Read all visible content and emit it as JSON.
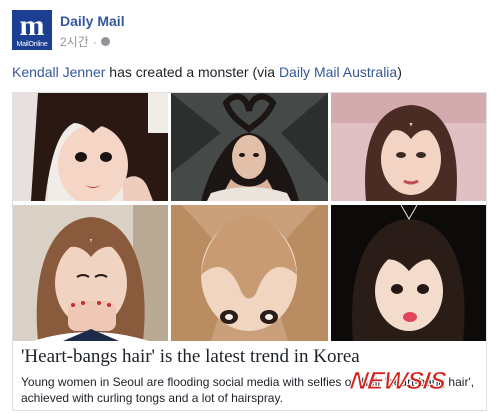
{
  "header": {
    "page_name": "Daily Mail",
    "timestamp": "2시간",
    "privacy_icon": "globe-icon",
    "avatar": {
      "logo_glyph": "m",
      "logo_text": "MailOnline",
      "bg_color": "#1c3f94"
    }
  },
  "caption": {
    "mention": "Kendall Jenner",
    "text_middle": " has created a monster (via ",
    "source_link": "Daily Mail Australia",
    "text_end": ")"
  },
  "link_card": {
    "photos": [
      "photo-1-heart-bangs",
      "photo-2-kendall-jenner",
      "photo-3-heart-bangs",
      "photo-4-heart-bangs",
      "photo-5-heart-bangs",
      "photo-6-heart-bangs"
    ],
    "headline": "'Heart-bangs hair' is the latest trend in Korea",
    "description": "Young women in Seoul are flooding social media with selfies of their 'heart-bang hair', achieved with curling tongs and a lot of hairspray."
  },
  "watermark": {
    "text": "NEWSIS",
    "color": "#d7201b"
  },
  "colors": {
    "link": "#365899",
    "text": "#1d2129",
    "meta": "#90949c"
  }
}
